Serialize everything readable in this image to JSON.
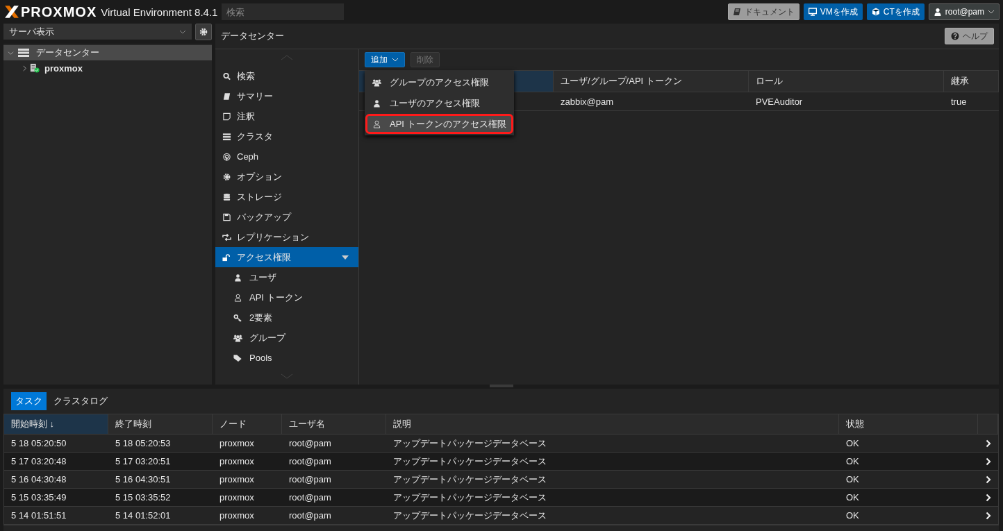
{
  "header": {
    "logo": "PROXMOX",
    "product": "Virtual Environment 8.4.1",
    "search": {
      "placeholder": "検索"
    },
    "buttons": [
      {
        "kind": "docs",
        "label": "ドキュメント"
      },
      {
        "kind": "vm",
        "label": "VMを作成"
      },
      {
        "kind": "ct",
        "label": "CTを作成"
      },
      {
        "kind": "user",
        "label": "root@pam"
      }
    ]
  },
  "sidebar": {
    "view_select": "サーバ表示",
    "tree": [
      {
        "label": "データセンター",
        "kind": "datacenter",
        "expanded": true,
        "selected": true,
        "children": [
          {
            "label": "proxmox",
            "kind": "node",
            "expanded": false,
            "selected": false
          }
        ]
      }
    ]
  },
  "content": {
    "title": "データセンター",
    "help": "ヘルプ",
    "nav": [
      {
        "kind": "search",
        "label": "検索",
        "selected": false
      },
      {
        "kind": "summary",
        "label": "サマリー",
        "selected": false
      },
      {
        "kind": "notes",
        "label": "注釈",
        "selected": false
      },
      {
        "kind": "cluster",
        "label": "クラスタ",
        "selected": false
      },
      {
        "kind": "ceph",
        "label": "Ceph",
        "selected": false
      },
      {
        "kind": "options",
        "label": "オプション",
        "selected": false
      },
      {
        "kind": "storage",
        "label": "ストレージ",
        "selected": false
      },
      {
        "kind": "backup",
        "label": "バックアップ",
        "selected": false
      },
      {
        "kind": "replication",
        "label": "レプリケーション",
        "selected": false
      },
      {
        "kind": "permissions",
        "label": "アクセス権限",
        "selected": true,
        "expanded": true,
        "children": [
          {
            "kind": "user",
            "label": "ユーザ",
            "selected": false
          },
          {
            "kind": "token",
            "label": "API トークン",
            "selected": false
          },
          {
            "kind": "tfa",
            "label": "2要素",
            "selected": false
          },
          {
            "kind": "group",
            "label": "グループ",
            "selected": false
          },
          {
            "kind": "pool",
            "label": "Pools",
            "selected": false
          }
        ]
      }
    ],
    "toolbar": {
      "add": "追加",
      "remove": {
        "label": "削除",
        "disabled": true
      }
    },
    "menu": [
      {
        "kind": "group",
        "label": "グループのアクセス権限",
        "selected": false,
        "outlined": false
      },
      {
        "kind": "user",
        "label": "ユーザのアクセス権限",
        "selected": false,
        "outlined": false
      },
      {
        "kind": "token",
        "label": "API トークンのアクセス権限",
        "selected": true,
        "outlined": true
      }
    ],
    "table": {
      "columns": [
        "ユーザ/グループ/API トークン",
        "ロール",
        "継承"
      ],
      "rows": [
        {
          "cells": [
            "zabbix@pam",
            "PVEAuditor",
            "true"
          ]
        }
      ]
    }
  },
  "bottom": {
    "tabs": [
      {
        "label": "タスク",
        "selected": true
      },
      {
        "label": "クラスタログ",
        "selected": false
      }
    ],
    "columns": [
      {
        "label": "開始時刻 ↓",
        "sorted": true
      },
      {
        "label": "終了時刻",
        "sorted": false
      },
      {
        "label": "ノード",
        "sorted": false
      },
      {
        "label": "ユーザ名",
        "sorted": false
      },
      {
        "label": "説明",
        "sorted": false
      },
      {
        "label": "状態",
        "sorted": false
      }
    ],
    "rows": [
      {
        "cells": [
          "5 18 05:20:50",
          "5 18 05:20:53",
          "proxmox",
          "root@pam",
          "アップデートパッケージデータベース",
          "OK"
        ]
      },
      {
        "cells": [
          "5 17 03:20:48",
          "5 17 03:20:51",
          "proxmox",
          "root@pam",
          "アップデートパッケージデータベース",
          "OK"
        ]
      },
      {
        "cells": [
          "5 16 04:30:48",
          "5 16 04:30:51",
          "proxmox",
          "root@pam",
          "アップデートパッケージデータベース",
          "OK"
        ]
      },
      {
        "cells": [
          "5 15 03:35:49",
          "5 15 03:35:52",
          "proxmox",
          "root@pam",
          "アップデートパッケージデータベース",
          "OK"
        ]
      },
      {
        "cells": [
          "5 14 01:51:51",
          "5 14 01:52:01",
          "proxmox",
          "root@pam",
          "アップデートパッケージデータベース",
          "OK"
        ]
      }
    ]
  }
}
